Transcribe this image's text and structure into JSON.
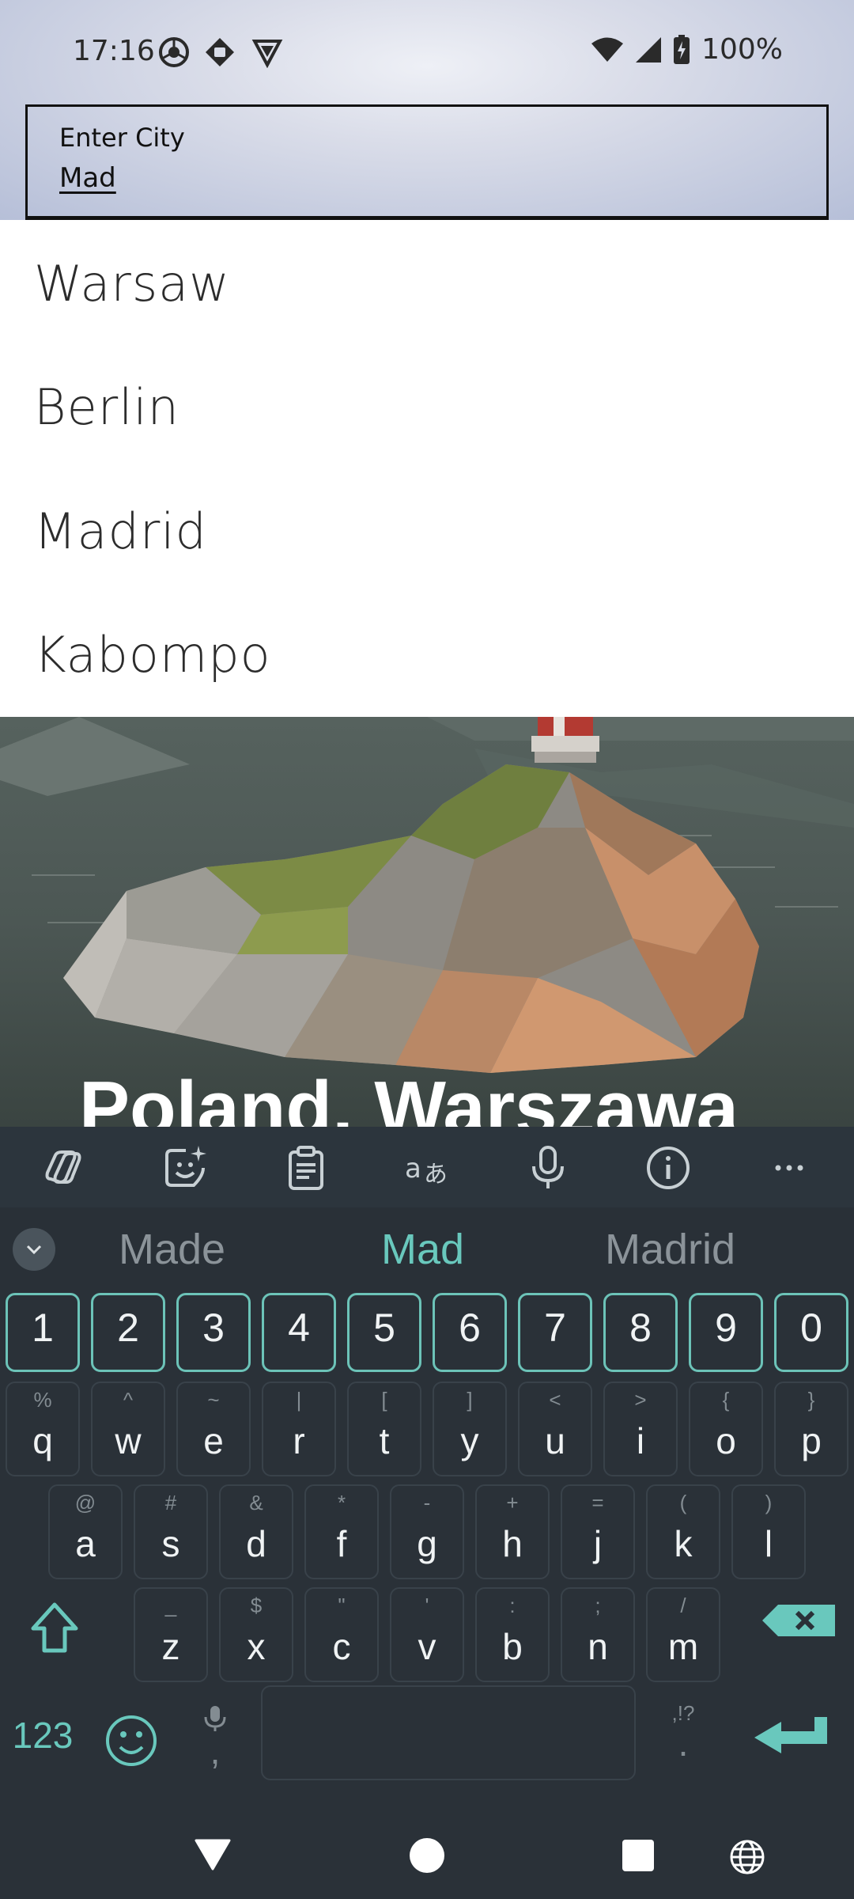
{
  "status_bar": {
    "time": "17:16",
    "battery": "100%",
    "left_icons": [
      "chrome-icon",
      "app-icon",
      "vpn-icon"
    ],
    "right_icons": [
      "wifi-icon",
      "signal-icon",
      "battery-charging-icon"
    ]
  },
  "city_input": {
    "label": "Enter City",
    "value": "Mad"
  },
  "suggestions_list": [
    "Warsaw",
    "Berlin",
    "Madrid",
    "Kabompo"
  ],
  "scene": {
    "title": "Poland, Warszawa"
  },
  "keyboard": {
    "toolbar_icons": [
      "copilot-icon",
      "sticker-icon",
      "clipboard-icon",
      "translate-icon",
      "microphone-icon",
      "info-icon",
      "more-icon"
    ],
    "suggestions": [
      "Made",
      "Mad",
      "Madrid"
    ],
    "active_suggestion_index": 1,
    "number_row": [
      "1",
      "2",
      "3",
      "4",
      "5",
      "6",
      "7",
      "8",
      "9",
      "0"
    ],
    "row1": [
      {
        "k": "q",
        "a": "%"
      },
      {
        "k": "w",
        "a": "^"
      },
      {
        "k": "e",
        "a": "~"
      },
      {
        "k": "r",
        "a": "|"
      },
      {
        "k": "t",
        "a": "["
      },
      {
        "k": "y",
        "a": "]"
      },
      {
        "k": "u",
        "a": "<"
      },
      {
        "k": "i",
        "a": ">"
      },
      {
        "k": "o",
        "a": "{"
      },
      {
        "k": "p",
        "a": "}"
      }
    ],
    "row2": [
      {
        "k": "a",
        "a": "@"
      },
      {
        "k": "s",
        "a": "#"
      },
      {
        "k": "d",
        "a": "&"
      },
      {
        "k": "f",
        "a": "*"
      },
      {
        "k": "g",
        "a": "-"
      },
      {
        "k": "h",
        "a": "+"
      },
      {
        "k": "j",
        "a": "="
      },
      {
        "k": "k",
        "a": "("
      },
      {
        "k": "l",
        "a": ")"
      }
    ],
    "row3": [
      {
        "k": "z",
        "a": "_"
      },
      {
        "k": "x",
        "a": "$"
      },
      {
        "k": "c",
        "a": "\""
      },
      {
        "k": "v",
        "a": "'"
      },
      {
        "k": "b",
        "a": ":"
      },
      {
        "k": "n",
        "a": ";"
      },
      {
        "k": "m",
        "a": "/"
      }
    ],
    "symbols_label": "123",
    "comma": ",",
    "period": ".",
    "period_alt": ",!?"
  },
  "colors": {
    "accent": "#69c8bd",
    "keyboard_bg": "#2a3138"
  }
}
